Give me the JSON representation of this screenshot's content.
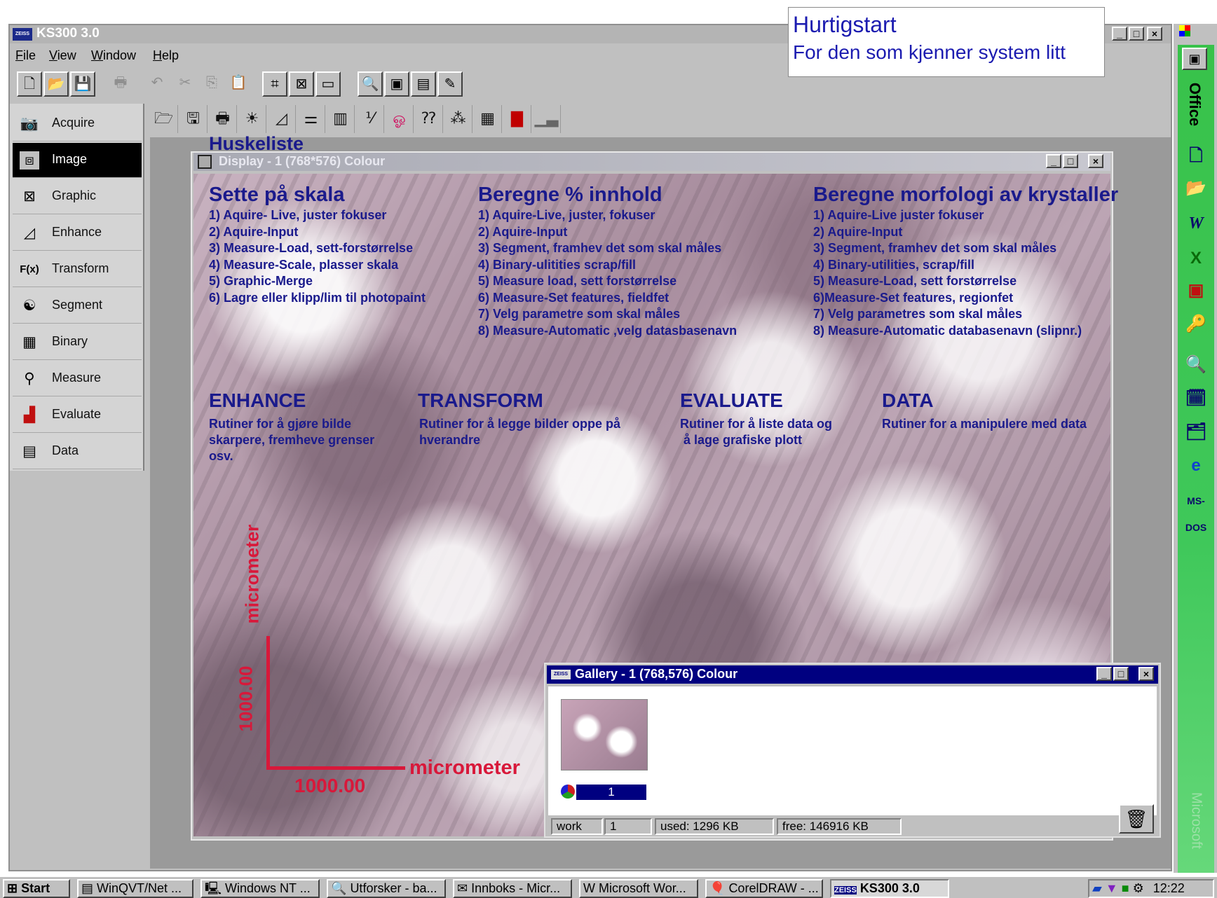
{
  "app": {
    "title": "KS300 3.0",
    "icon_label": "ZEISS"
  },
  "menu": [
    "File",
    "View",
    "Window",
    "Help"
  ],
  "note": {
    "line1": "Hurtigstart",
    "line2": "For den som kjenner system litt"
  },
  "sidebar": {
    "items": [
      {
        "label": "Acquire",
        "icon": "camera-icon"
      },
      {
        "label": "Image",
        "icon": "frame-icon"
      },
      {
        "label": "Graphic",
        "icon": "graphic-icon"
      },
      {
        "label": "Enhance",
        "icon": "enhance-icon"
      },
      {
        "label": "Transform",
        "icon": "fx-icon",
        "glyph": "F(x)"
      },
      {
        "label": "Segment",
        "icon": "yin-yang-icon"
      },
      {
        "label": "Binary",
        "icon": "binary-icon"
      },
      {
        "label": "Measure",
        "icon": "measure-icon"
      },
      {
        "label": "Evaluate",
        "icon": "evaluate-icon"
      },
      {
        "label": "Data",
        "icon": "calculator-icon"
      }
    ],
    "active": "Image"
  },
  "overlay_title": "Huskeliste",
  "display_window": {
    "title": "Display - 1 (768*576) Colour"
  },
  "sections": {
    "scale": {
      "heading": "Sette på skala",
      "steps": [
        "1) Aquire- Live, juster fokuser",
        "2) Aquire-Input",
        "3) Measure-Load, sett-forstørrelse",
        "4) Measure-Scale, plasser skala",
        "5) Graphic-Merge",
        "6) Lagre eller klipp/lim til photopaint"
      ]
    },
    "percent": {
      "heading": "Beregne % innhold",
      "steps": [
        "1) Aquire-Live, juster, fokuser",
        "2) Aquire-Input",
        "3) Segment, framhev det som skal måles",
        "4) Binary-ulitities scrap/fill",
        "5) Measure load, sett forstørrelse",
        "6) Measure-Set features, fieldfet",
        "7) Velg parametre som skal måles",
        "8) Measure-Automatic ,velg datasbasenavn"
      ]
    },
    "morph": {
      "heading": "Beregne morfologi av krystaller",
      "steps": [
        "1) Aquire-Live juster fokuser",
        "2) Aquire-Input",
        "3) Segment, framhev det som skal måles",
        "4) Binary-utilities, scrap/fill",
        "5) Measure-Load, sett forstørrelse",
        "6)Measure-Set features, regionfet",
        "7) Velg parametres som skal måles",
        "8) Measure-Automatic databasenavn (slipnr.)"
      ]
    },
    "enhance": {
      "heading": "ENHANCE",
      "desc": [
        "Rutiner for å gjøre bilde",
        "skarpere, fremheve grenser",
        "osv."
      ]
    },
    "transform": {
      "heading": "TRANSFORM",
      "desc": [
        "Rutiner for å legge bilder oppe på",
        "hverandre"
      ]
    },
    "evaluate": {
      "heading": "EVALUATE",
      "desc": [
        "Rutiner for å liste data og",
        " å lage grafiske plott"
      ]
    },
    "data": {
      "heading": "DATA",
      "desc": [
        "Rutiner for a manipulere med data"
      ]
    }
  },
  "scale_bar": {
    "v_unit": "micrometer",
    "v_value": "1000.00",
    "h_unit": "micrometer",
    "h_value": "1000.00"
  },
  "gallery": {
    "title": "Gallery - 1 (768,576) Colour",
    "thumb_index": "1",
    "status": {
      "name": "work",
      "count": "1",
      "used": "used: 1296 KB",
      "free": "free: 146916 KB"
    }
  },
  "office_bar": {
    "label": "Office",
    "footer": "Microsoft"
  },
  "taskbar": {
    "start": "Start",
    "tasks": [
      "WinQVT/Net ...",
      "Windows NT ...",
      "Utforsker - ba...",
      "Innboks - Micr...",
      "Microsoft Wor...",
      "CorelDRAW - ...",
      "KS300 3.0"
    ],
    "clock": "12:22"
  },
  "colors": {
    "title_active": "#000080",
    "annotation_blue": "#1a1a8c",
    "scale_red": "#d8183a",
    "office_green": "#3fc85a"
  }
}
